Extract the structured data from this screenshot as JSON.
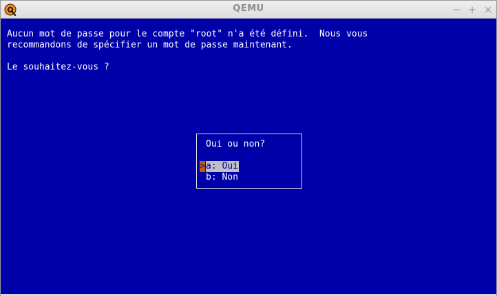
{
  "window": {
    "title": "QEMU",
    "minimize_glyph": "−",
    "maximize_glyph": "+",
    "close_glyph": "×",
    "app_icon": "qemu-logo-icon"
  },
  "console": {
    "line1": "Aucun mot de passe pour le compte \"root\" n'a été défini.  Nous vous",
    "line2": "recommandons de spécifier un mot de passe maintenant.",
    "line3": "Le souhaitez-vous ?"
  },
  "dialog": {
    "title": "Oui ou non?",
    "cursor": ">",
    "options": [
      {
        "label": "a: Oui",
        "selected": true
      },
      {
        "label": "b: Non",
        "selected": false
      }
    ]
  },
  "colors": {
    "screen_bg": "#0000a8",
    "text": "#ffffff",
    "highlight_bg": "#c0c0c0",
    "cursor_bg": "#c06000"
  }
}
